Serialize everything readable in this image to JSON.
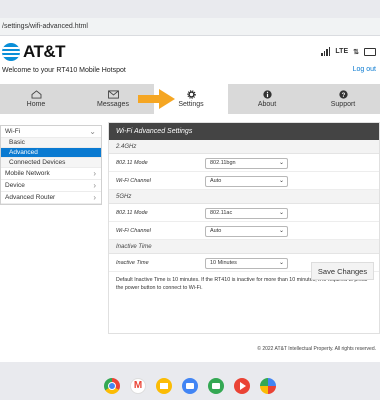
{
  "browser": {
    "url": "/settings/wifi-advanced.html"
  },
  "header": {
    "brand": "AT&T",
    "welcome": "Welcome to your RT410 Mobile Hotspot",
    "network": "LTE",
    "logout": "Log out"
  },
  "nav": {
    "tabs": [
      "Home",
      "Messages",
      "Settings",
      "About",
      "Support"
    ],
    "active": "Settings"
  },
  "sidebar": {
    "wifi": "Wi-Fi",
    "basic": "Basic",
    "advanced": "Advanced",
    "connected": "Connected Devices",
    "mobile": "Mobile Network",
    "device": "Device",
    "router": "Advanced Router"
  },
  "panel": {
    "title": "Wi-Fi Advanced Settings",
    "sec_24": "2.4GHz",
    "mode_label": "802.11 Mode",
    "mode_24": "802.11bgn",
    "channel_label": "Wi-Fi Channel",
    "channel_24": "Auto",
    "sec_5": "5GHz",
    "mode_5": "802.11ac",
    "channel_5": "Auto",
    "sec_inactive": "Inactive Time",
    "inactive_label": "Inactive Time",
    "inactive_value": "10 Minutes",
    "note": "Default Inactive Time is 10 minutes. If the RT410 is inactive for more than 10 minutes, it is required to press the power button to connect to Wi-Fi.",
    "save": "Save Changes"
  },
  "footer": "© 2022 AT&T Intellectual Property. All rights reserved.",
  "colors": {
    "accent": "#0a7ad1",
    "highlight_arrow": "#f5a623",
    "panel_header": "#444444"
  }
}
